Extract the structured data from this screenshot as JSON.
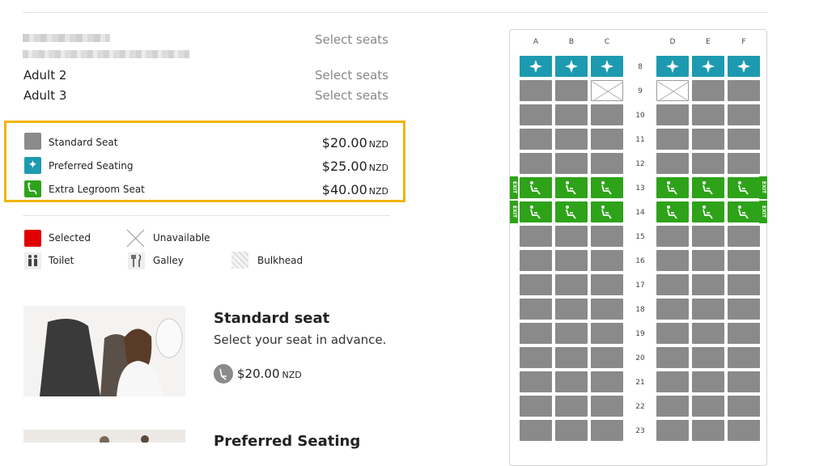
{
  "passengers": [
    {
      "name": "",
      "action": "Select seats"
    },
    {
      "name": "Adult 2",
      "action": "Select seats"
    },
    {
      "name": "Adult 3",
      "action": "Select seats"
    }
  ],
  "seat_types": [
    {
      "label": "Standard Seat",
      "price": "$20.00",
      "currency": "NZD",
      "icon": "standard-seat",
      "color": "#8a8a8a"
    },
    {
      "label": "Preferred Seating",
      "price": "$25.00",
      "currency": "NZD",
      "icon": "star-sparkle",
      "color": "#1e9ab0"
    },
    {
      "label": "Extra Legroom Seat",
      "price": "$40.00",
      "currency": "NZD",
      "icon": "reclined-seat",
      "color": "#2ea31a"
    }
  ],
  "key": {
    "selected": "Selected",
    "unavailable": "Unavailable",
    "toilet": "Toilet",
    "galley": "Galley",
    "bulkhead": "Bulkhead",
    "selected_color": "#e00000"
  },
  "cards": [
    {
      "title": "Standard seat",
      "description": "Select your seat in advance.",
      "price": "$20.00",
      "currency": "NZD"
    },
    {
      "title": "Preferred Seating"
    }
  ],
  "seatmap": {
    "columns_left": [
      "A",
      "B",
      "C"
    ],
    "columns_right": [
      "D",
      "E",
      "F"
    ],
    "exit_label": "EXIT",
    "rows": [
      {
        "num": "8",
        "seats": [
          "pref",
          "pref",
          "pref",
          "pref",
          "pref",
          "pref"
        ]
      },
      {
        "num": "9",
        "seats": [
          "std",
          "std",
          "unav",
          "unav",
          "std",
          "std"
        ]
      },
      {
        "num": "10",
        "seats": [
          "std",
          "std",
          "std",
          "std",
          "std",
          "std"
        ]
      },
      {
        "num": "11",
        "seats": [
          "std",
          "std",
          "std",
          "std",
          "std",
          "std"
        ]
      },
      {
        "num": "12",
        "seats": [
          "std",
          "std",
          "std",
          "std",
          "std",
          "std"
        ]
      },
      {
        "num": "13",
        "seats": [
          "xleg",
          "xleg",
          "xleg",
          "xleg",
          "xleg",
          "xleg"
        ],
        "exit": true
      },
      {
        "num": "14",
        "seats": [
          "xleg",
          "xleg",
          "xleg",
          "xleg",
          "xleg",
          "xleg"
        ],
        "exit": true
      },
      {
        "num": "15",
        "seats": [
          "std",
          "std",
          "std",
          "std",
          "std",
          "std"
        ]
      },
      {
        "num": "16",
        "seats": [
          "std",
          "std",
          "std",
          "std",
          "std",
          "std"
        ]
      },
      {
        "num": "17",
        "seats": [
          "std",
          "std",
          "std",
          "std",
          "std",
          "std"
        ]
      },
      {
        "num": "18",
        "seats": [
          "std",
          "std",
          "std",
          "std",
          "std",
          "std"
        ]
      },
      {
        "num": "19",
        "seats": [
          "std",
          "std",
          "std",
          "std",
          "std",
          "std"
        ]
      },
      {
        "num": "20",
        "seats": [
          "std",
          "std",
          "std",
          "std",
          "std",
          "std"
        ]
      },
      {
        "num": "21",
        "seats": [
          "std",
          "std",
          "std",
          "std",
          "std",
          "std"
        ]
      },
      {
        "num": "22",
        "seats": [
          "std",
          "std",
          "std",
          "std",
          "std",
          "std"
        ]
      },
      {
        "num": "23",
        "seats": [
          "std",
          "std",
          "std",
          "std",
          "std",
          "std"
        ]
      }
    ]
  }
}
